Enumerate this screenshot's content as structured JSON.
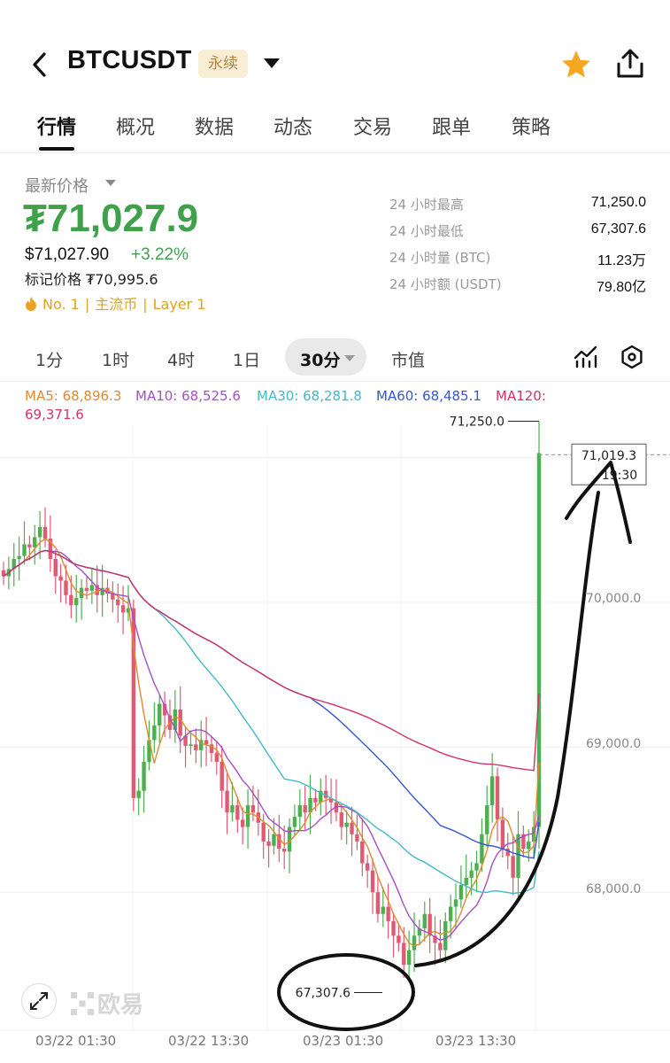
{
  "header": {
    "pair": "BTCUSDT",
    "contract_type": "永续"
  },
  "tabs": [
    "行情",
    "概况",
    "数据",
    "动态",
    "交易",
    "跟单",
    "策略"
  ],
  "price": {
    "latest_label": "最新价格",
    "last": "₮71,027.9",
    "usd": "$71,027.90",
    "change_pct": "+3.22%",
    "mark_label": "标记价格",
    "mark": "₮70,995.6",
    "tags": [
      "No. 1",
      "主流币",
      "Layer 1"
    ]
  },
  "stats": [
    {
      "label": "24 小时最高",
      "value": "71,250.0"
    },
    {
      "label": "24 小时最低",
      "value": "67,307.6"
    },
    {
      "label": "24 小时量 (BTC)",
      "value": "11.23万"
    },
    {
      "label": "24 小时额 (USDT)",
      "value": "79.80亿"
    }
  ],
  "intervals": [
    "1分",
    "1时",
    "4时",
    "1日",
    "30分",
    "市值"
  ],
  "active_interval": "30分",
  "ma": {
    "ma5": "MA5: 68,896.3",
    "ma10": "MA10: 68,525.6",
    "ma30": "MA30: 68,281.8",
    "ma60": "MA60: 68,485.1",
    "ma120_label": "MA120:",
    "ma120_value": "69,371.6"
  },
  "colors": {
    "up": "#4caf50",
    "down": "#e05a73",
    "ma5": "#e08a2c",
    "ma10": "#a54fc4",
    "ma30": "#43b9c8",
    "ma60": "#3357d0",
    "ma120": "#cf3563",
    "accent_gold": "#e0a21c"
  },
  "chart_data": {
    "type": "candlestick",
    "y_axis": [
      "71,000.0",
      "70,000.0",
      "69,000.0",
      "68,000.0"
    ],
    "y_ticks": [
      71000,
      70000,
      69000,
      68000
    ],
    "x_axis": [
      "03/22 01:30",
      "03/22 13:30",
      "03/23 01:30",
      "03/23 13:30"
    ],
    "high_label": "71,250.0",
    "low_label": "67,307.6",
    "current_label": "71,019.3",
    "current_time_label": "19:30",
    "high": 71250.0,
    "low": 67307.6
  },
  "watermark": "欧易"
}
